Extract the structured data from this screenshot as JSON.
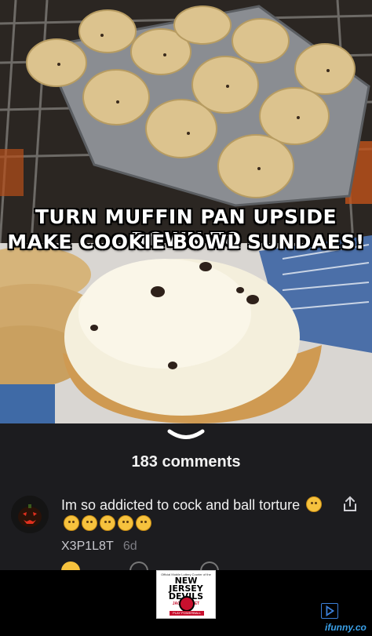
{
  "meme": {
    "caption_line1": "TURN MUFFIN PAN UPSIDE DOWN TO",
    "caption_line2": "MAKE COOKIE BOWL SUNDAES!"
  },
  "comments": {
    "expand_icon": "chevron-down-icon",
    "count_label": "183 comments"
  },
  "comment": {
    "avatar": "jack-o-lantern-avatar",
    "text": "Im so addicted to cock and ball torture",
    "emojis": [
      "drooling-face",
      "tired-face",
      "tired-face",
      "relieved-face",
      "flushed-face",
      "flushed-face"
    ],
    "username": "X3P1L8T",
    "age": "6d",
    "share_icon": "share-icon"
  },
  "ad": {
    "line1": "Official Mobile Lottery Courier of the",
    "line2": "NEW JERSEY DEVILS",
    "line3": "JACKPOCKET",
    "cta": "PLAY POWERBALL",
    "choices_icon": "adchoices-icon"
  },
  "watermark": "ifunny.co",
  "colors": {
    "background": "#1c1c1f",
    "accent_emoji": "#f6c23e",
    "watermark": "#3aa0e8"
  }
}
